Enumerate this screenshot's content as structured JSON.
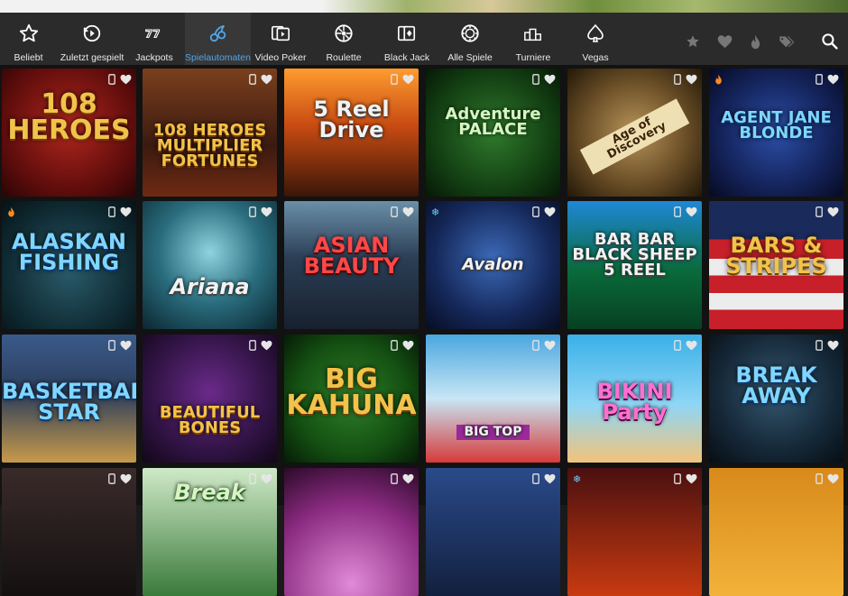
{
  "nav": {
    "items": [
      {
        "label": "Beliebt",
        "icon": "star-icon"
      },
      {
        "label": "Zuletzt gespielt",
        "icon": "history-icon"
      },
      {
        "label": "Jackpots",
        "icon": "jackpot-777-icon"
      },
      {
        "label": "Spielautomaten",
        "icon": "cherries-icon",
        "active": true
      },
      {
        "label": "Video Poker",
        "icon": "video-poker-icon"
      },
      {
        "label": "Roulette",
        "icon": "roulette-icon"
      },
      {
        "label": "Black Jack",
        "icon": "cards-icon"
      },
      {
        "label": "Alle Spiele",
        "icon": "chip-icon"
      },
      {
        "label": "Turniere",
        "icon": "podium-icon"
      },
      {
        "label": "Vegas",
        "icon": "spade-icon"
      }
    ],
    "active_color": "#4fa6e8"
  },
  "games": [
    {
      "title": "108 HEROES",
      "hot": false
    },
    {
      "title": "108 HEROES MULTIPLIER FORTUNES",
      "hot": false
    },
    {
      "title": "5 Reel Drive",
      "hot": false
    },
    {
      "title": "Adventure PALACE",
      "hot": false
    },
    {
      "title": "Age of Discovery",
      "hot": false
    },
    {
      "title": "AGENT JANE BLONDE",
      "hot": true
    },
    {
      "title": "ALASKAN FISHING",
      "hot": true
    },
    {
      "title": "Ariana",
      "hot": false
    },
    {
      "title": "ASIAN BEAUTY",
      "hot": false
    },
    {
      "title": "Avalon",
      "hot": false,
      "new": true
    },
    {
      "title": "BAR BAR BLACK SHEEP 5 REEL",
      "hot": false
    },
    {
      "title": "BARS & STRIPES",
      "hot": false
    },
    {
      "title": "BASKETBALL STAR",
      "hot": false
    },
    {
      "title": "BEAUTIFUL BONES",
      "hot": false
    },
    {
      "title": "BIG KAHUNA",
      "hot": false
    },
    {
      "title": "BIG TOP",
      "hot": false
    },
    {
      "title": "BIKINI Party",
      "hot": false
    },
    {
      "title": "BREAK AWAY",
      "hot": false
    },
    {
      "title": "",
      "hot": false
    },
    {
      "title": "Break",
      "hot": false
    },
    {
      "title": "",
      "hot": false
    },
    {
      "title": "",
      "hot": false
    },
    {
      "title": "",
      "hot": false,
      "new": true
    },
    {
      "title": "",
      "hot": false
    }
  ]
}
